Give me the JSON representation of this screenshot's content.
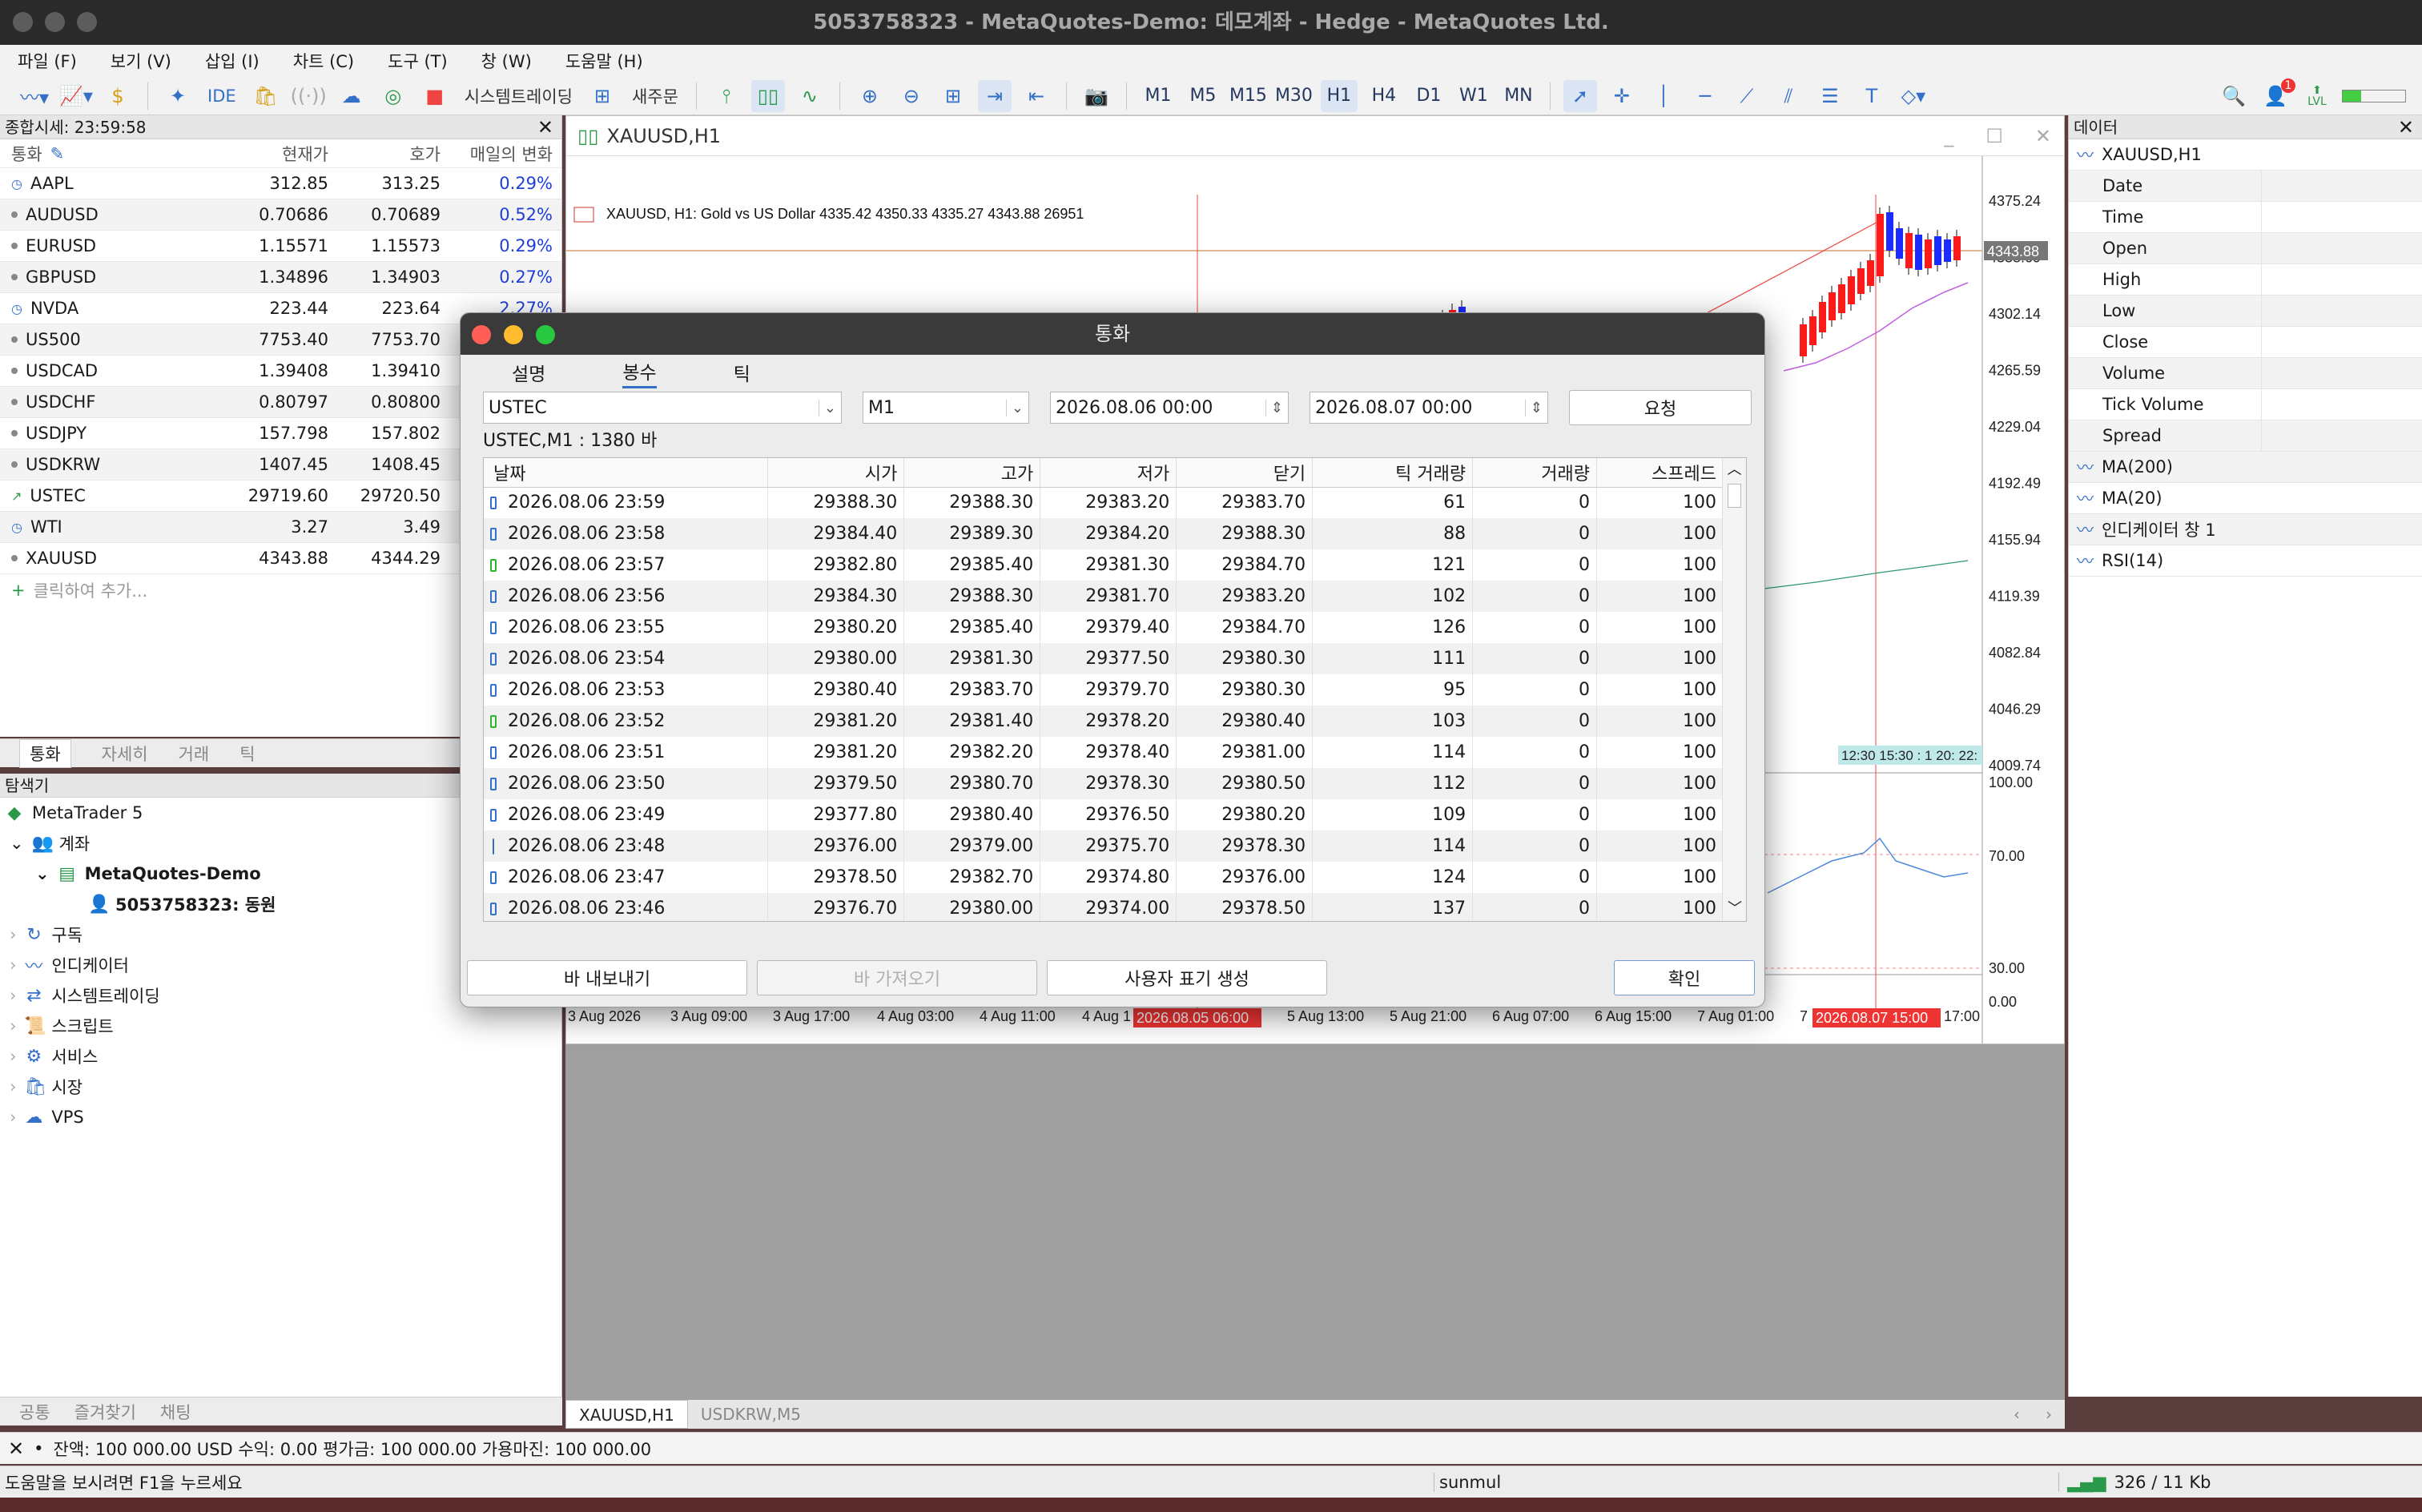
{
  "window": {
    "title": "5053758323 - MetaQuotes-Demo: 데모계좌 - Hedge - MetaQuotes Ltd."
  },
  "menu": [
    "파일 (F)",
    "보기 (V)",
    "삽입 (I)",
    "차트 (C)",
    "도구 (T)",
    "창 (W)",
    "도움말 (H)"
  ],
  "toolbar": {
    "ide": "IDE",
    "algo": "시스템트레이딩",
    "new_order": "새주문",
    "timeframes": [
      "M1",
      "M5",
      "M15",
      "M30",
      "H1",
      "H4",
      "D1",
      "W1",
      "MN"
    ],
    "selected_tf": "H1",
    "notif_count": "1",
    "lvl": "LVL"
  },
  "market_watch": {
    "title": "종합시세: 23:59:58",
    "headers": {
      "symbol": "통화",
      "bid": "현재가",
      "ask": "호가",
      "change": "매일의 변화"
    },
    "rows": [
      {
        "sym": "AAPL",
        "bid": "312.85",
        "ask": "313.25",
        "chg": "0.29%"
      },
      {
        "sym": "AUDUSD",
        "bid": "0.70686",
        "ask": "0.70689",
        "chg": "0.52%"
      },
      {
        "sym": "EURUSD",
        "bid": "1.15571",
        "ask": "1.15573",
        "chg": "0.29%"
      },
      {
        "sym": "GBPUSD",
        "bid": "1.34896",
        "ask": "1.34903",
        "chg": "0.27%"
      },
      {
        "sym": "NVDA",
        "bid": "223.44",
        "ask": "223.64",
        "chg": "2.27%"
      },
      {
        "sym": "US500",
        "bid": "7753.40",
        "ask": "7753.70",
        "chg": ""
      },
      {
        "sym": "USDCAD",
        "bid": "1.39408",
        "ask": "1.39410",
        "chg": ""
      },
      {
        "sym": "USDCHF",
        "bid": "0.80797",
        "ask": "0.80800",
        "chg": ""
      },
      {
        "sym": "USDJPY",
        "bid": "157.798",
        "ask": "157.802",
        "chg": ""
      },
      {
        "sym": "USDKRW",
        "bid": "1407.45",
        "ask": "1408.45",
        "chg": ""
      },
      {
        "sym": "USTEC",
        "bid": "29719.60",
        "ask": "29720.50",
        "chg": ""
      },
      {
        "sym": "WTI",
        "bid": "3.27",
        "ask": "3.49",
        "chg": ""
      },
      {
        "sym": "XAUUSD",
        "bid": "4343.88",
        "ask": "4344.29",
        "chg": ""
      }
    ],
    "add_label": "클릭하여 추가...",
    "tabs": [
      "통화",
      "자세히",
      "거래",
      "틱"
    ]
  },
  "navigator": {
    "title": "탐색기",
    "root": "MetaTrader 5",
    "accounts": "계좌",
    "server": "MetaQuotes-Demo",
    "account": "5053758323: 동원",
    "items": [
      "구독",
      "인디케이터",
      "시스템트레이딩",
      "스크립트",
      "서비스",
      "시장",
      "VPS"
    ],
    "tabs": [
      "공통",
      "즐겨찾기",
      "채팅"
    ]
  },
  "chart": {
    "window_title": "XAUUSD,H1",
    "info": "XAUUSD, H1:  Gold vs US Dollar  4335.42 4350.33 4335.27 4343.88  26951",
    "price_labels": [
      "4375.24",
      "4338.69",
      "4302.14",
      "4265.59",
      "4229.04",
      "4192.49",
      "4155.94",
      "4119.39",
      "4082.84",
      "4046.29",
      "4009.74"
    ],
    "current_price": "4343.88",
    "rsi_labels": [
      "100.00",
      "70.00",
      "30.00",
      "0.00"
    ],
    "time_labels": [
      "3 Aug 2026",
      "3 Aug 09:00",
      "3 Aug 17:00",
      "4 Aug 03:00",
      "4 Aug 11:00",
      "4 Aug 1",
      "5 Aug 13:00",
      "5 Aug 21:00",
      "6 Aug 07:00",
      "6 Aug 15:00",
      "7 Aug 01:00",
      "7",
      "17:00"
    ],
    "crosshair_time_1": "2026.08.05 06:00",
    "crosshair_time_2": "2026.08.07 15:00",
    "mini_times": "12:30 15:30 : 1 20: 22:",
    "tabs": [
      "XAUUSD,H1",
      "USDKRW,M5"
    ]
  },
  "data_window": {
    "title": "데이터",
    "symbol": "XAUUSD,H1",
    "fields": [
      "Date",
      "Time",
      "Open",
      "High",
      "Low",
      "Close",
      "Volume",
      "Tick Volume",
      "Spread"
    ],
    "indicators": [
      "MA(200)",
      "MA(20)",
      "인디케이터 창 1",
      "RSI(14)"
    ]
  },
  "dialog": {
    "title": "통화",
    "tabs": [
      "설명",
      "봉수",
      "틱"
    ],
    "active_tab": "봉수",
    "symbol": "USTEC",
    "timeframe": "M1",
    "from": "2026.08.06 00:00",
    "to": "2026.08.07 00:00",
    "request_btn": "요청",
    "info": "USTEC,M1 : 1380 바",
    "headers": [
      "날짜",
      "시가",
      "고가",
      "저가",
      "닫기",
      "틱 거래량",
      "거래량",
      "스프레드"
    ],
    "rows": [
      {
        "d": "2026.08.06 23:59",
        "o": "29388.30",
        "h": "29388.30",
        "l": "29383.20",
        "c": "29383.70",
        "tv": "61",
        "v": "0",
        "s": "100",
        "k": "b"
      },
      {
        "d": "2026.08.06 23:58",
        "o": "29384.40",
        "h": "29389.30",
        "l": "29384.20",
        "c": "29388.30",
        "tv": "88",
        "v": "0",
        "s": "100",
        "k": "b"
      },
      {
        "d": "2026.08.06 23:57",
        "o": "29382.80",
        "h": "29385.40",
        "l": "29381.30",
        "c": "29384.70",
        "tv": "121",
        "v": "0",
        "s": "100",
        "k": "g"
      },
      {
        "d": "2026.08.06 23:56",
        "o": "29384.30",
        "h": "29388.30",
        "l": "29381.70",
        "c": "29383.20",
        "tv": "102",
        "v": "0",
        "s": "100",
        "k": "b"
      },
      {
        "d": "2026.08.06 23:55",
        "o": "29380.20",
        "h": "29385.40",
        "l": "29379.40",
        "c": "29384.70",
        "tv": "126",
        "v": "0",
        "s": "100",
        "k": "b"
      },
      {
        "d": "2026.08.06 23:54",
        "o": "29380.00",
        "h": "29381.30",
        "l": "29377.50",
        "c": "29380.30",
        "tv": "111",
        "v": "0",
        "s": "100",
        "k": "b"
      },
      {
        "d": "2026.08.06 23:53",
        "o": "29380.40",
        "h": "29383.70",
        "l": "29379.70",
        "c": "29380.30",
        "tv": "95",
        "v": "0",
        "s": "100",
        "k": "b"
      },
      {
        "d": "2026.08.06 23:52",
        "o": "29381.20",
        "h": "29381.40",
        "l": "29378.20",
        "c": "29380.40",
        "tv": "103",
        "v": "0",
        "s": "100",
        "k": "g"
      },
      {
        "d": "2026.08.06 23:51",
        "o": "29381.20",
        "h": "29382.20",
        "l": "29378.40",
        "c": "29381.00",
        "tv": "114",
        "v": "0",
        "s": "100",
        "k": "b"
      },
      {
        "d": "2026.08.06 23:50",
        "o": "29379.50",
        "h": "29380.70",
        "l": "29378.30",
        "c": "29380.50",
        "tv": "112",
        "v": "0",
        "s": "100",
        "k": "b"
      },
      {
        "d": "2026.08.06 23:49",
        "o": "29377.80",
        "h": "29380.40",
        "l": "29376.50",
        "c": "29380.20",
        "tv": "109",
        "v": "0",
        "s": "100",
        "k": "b"
      },
      {
        "d": "2026.08.06 23:48",
        "o": "29376.00",
        "h": "29379.00",
        "l": "29375.70",
        "c": "29378.30",
        "tv": "114",
        "v": "0",
        "s": "100",
        "k": "line"
      },
      {
        "d": "2026.08.06 23:47",
        "o": "29378.50",
        "h": "29382.70",
        "l": "29374.80",
        "c": "29376.00",
        "tv": "124",
        "v": "0",
        "s": "100",
        "k": "b"
      },
      {
        "d": "2026.08.06 23:46",
        "o": "29376.70",
        "h": "29380.00",
        "l": "29374.00",
        "c": "29378.50",
        "tv": "137",
        "v": "0",
        "s": "100",
        "k": "b"
      }
    ],
    "export_btn": "바 내보내기",
    "import_btn": "바 가져오기",
    "create_btn": "사용자 표기 생성",
    "ok_btn": "확인"
  },
  "account_bar": "잔액: 100 000.00 USD  수익: 0.00  평가금: 100 000.00  가용마진: 100 000.00",
  "status": {
    "help": "도움말을 보시려면 F1을 누르세요",
    "profile": "sunmul",
    "traffic": "326 / 11 Kb"
  }
}
